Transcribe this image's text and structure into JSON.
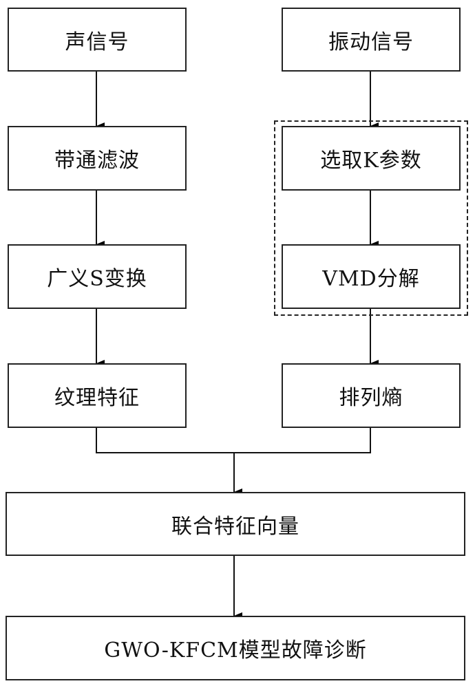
{
  "diagram": {
    "left_column": [
      {
        "id": "acoustic-signal",
        "label": "声信号"
      },
      {
        "id": "bandpass-filter",
        "label": "带通滤波"
      },
      {
        "id": "generalized-s-transform",
        "label": "广义S变换"
      },
      {
        "id": "texture-features",
        "label": "纹理特征"
      }
    ],
    "right_column": [
      {
        "id": "vibration-signal",
        "label": "振动信号"
      },
      {
        "id": "select-k-parameter",
        "label": "选取K参数"
      },
      {
        "id": "vmd-decomposition",
        "label": "VMD分解"
      },
      {
        "id": "permutation-entropy",
        "label": "排列熵"
      }
    ],
    "merge": {
      "id": "joint-feature-vector",
      "label": "联合特征向量"
    },
    "output": {
      "id": "gwo-kfcm-diagnosis",
      "label": "GWO-KFCM模型故障诊断"
    },
    "group": {
      "id": "vmd-group",
      "members": [
        "选取K参数",
        "VMD分解"
      ],
      "style": "dashed"
    }
  }
}
